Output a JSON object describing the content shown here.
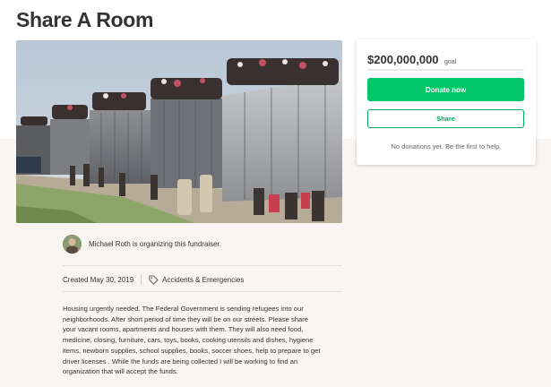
{
  "page": {
    "title": "Share A Room"
  },
  "campaign": {
    "amount": "$200,000,000",
    "goal_label": "goal",
    "progress_percent": 0,
    "donate_label": "Donate now",
    "share_label": "Share",
    "no_donations_text": "No donations yet. Be the first to help."
  },
  "organizer": {
    "text": "Michael Roth is organizing this fundraiser."
  },
  "meta": {
    "created": "Created May 30, 2019",
    "category": "Accidents & Emergencies"
  },
  "story": {
    "lines": [
      "Housing urgently needed. The Federal Government is sending refugees into our",
      "neighborhoods.  After short period of time they will be on our streets.    Please share",
      "your vacant rooms, apartments and houses with them.  They will also need food,",
      "medicine, closing, furniture, cars, toys, books,  cooking utensils and dishes,  hygiene",
      "items,  newborn supplies,  school supplies,  books,  soccer shoes, help to prepare to get",
      "driver licenses .  While  the funds are being collected I  will be working to find an",
      "organization that will accept the funds."
    ]
  },
  "colors": {
    "brand_green": "#02c668",
    "share_border": "#02a95c",
    "lower_bg": "#f9f5f2"
  },
  "icons": {
    "tag": "tag-icon",
    "avatar": "avatar"
  }
}
